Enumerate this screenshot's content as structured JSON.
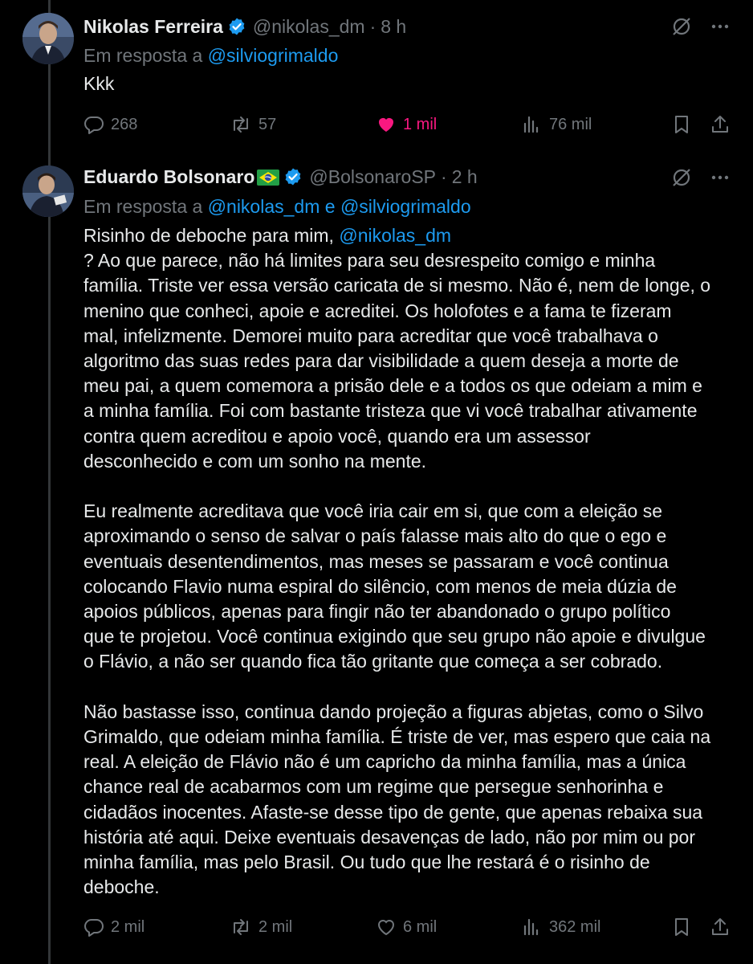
{
  "posts": [
    {
      "author_name": "Nikolas Ferreira",
      "handle": "@nikolas_dm",
      "time": "8 h",
      "reply_prefix": "Em resposta a ",
      "reply_users": [
        "@silviogrimaldo"
      ],
      "reply_conjunction": " e ",
      "text": "Kkk",
      "stats": {
        "replies": "268",
        "reposts": "57",
        "likes": "1 mil",
        "views": "76 mil"
      },
      "liked": true
    },
    {
      "author_name": "Eduardo Bolsonaro",
      "handle": "@BolsonaroSP",
      "time": "2 h",
      "reply_prefix": "Em resposta a ",
      "reply_users": [
        "@nikolas_dm",
        "@silviogrimaldo"
      ],
      "reply_conjunction": " e ",
      "mention_intro": "Risinho de deboche para mim, ",
      "mention": "@nikolas_dm",
      "lines_p1": [
        "? Ao que parece, não há limites para seu desrespeito comigo e minha",
        "família. Triste ver essa versão caricata de si mesmo. Não é, nem de longe, o",
        "menino que conheci, apoie e acreditei. Os holofotes e a fama te fizeram",
        "mal, infelizmente. Demorei muito para acreditar que você trabalhava o",
        "algoritmo das suas redes para dar visibilidade a quem deseja a morte de",
        "meu pai, a quem comemora a prisão dele e a todos os que odeiam a mim e",
        "a minha família. Foi com bastante tristeza que vi você trabalhar ativamente",
        "contra quem acreditou e apoio você, quando era um assessor",
        "desconhecido e com um sonho na mente."
      ],
      "lines_p2": [
        "Eu realmente acreditava que você iria cair em si, que com a eleição se",
        "aproximando o senso de salvar o país falasse mais alto do que o ego e",
        "eventuais desentendimentos, mas meses se passaram e você continua",
        "colocando Flavio numa espiral do silêncio, com menos de meia dúzia de",
        "apoios públicos, apenas para fingir não ter abandonado o grupo político",
        "que te projetou. Você continua exigindo que seu grupo não apoie e divulgue",
        "o Flávio, a não ser quando fica tão gritante que começa a ser cobrado."
      ],
      "lines_p3": [
        "Não bastasse isso, continua dando projeção a figuras abjetas, como o Silvo",
        "Grimaldo, que odeiam minha família. É triste de ver, mas espero que caia na",
        "real. A eleição de Flávio não é um capricho da minha família, mas a única",
        "chance real de acabarmos com um regime que persegue senhorinha e",
        "cidadãos inocentes. Afaste-se desse tipo de gente, que apenas rebaixa sua",
        "história até aqui. Deixe eventuais desavenças de lado, não por mim ou por",
        "minha família, mas pelo Brasil. Ou tudo que lhe restará é o risinho de",
        "deboche."
      ],
      "stats": {
        "replies": "2 mil",
        "reposts": "2 mil",
        "likes": "6 mil",
        "views": "362 mil"
      },
      "liked": false
    }
  ],
  "separator": "·",
  "icons": [
    "verified-badge-icon",
    "grok-icon",
    "more-icon",
    "reply-icon",
    "repost-icon",
    "like-icon",
    "views-icon",
    "bookmark-icon",
    "share-icon",
    "brazil-flag-icon"
  ],
  "colors": {
    "background": "#000000",
    "text": "#e7e9ea",
    "muted": "#71767b",
    "link": "#1d9bf0",
    "like": "#f91880",
    "verified": "#1d9bf0"
  }
}
